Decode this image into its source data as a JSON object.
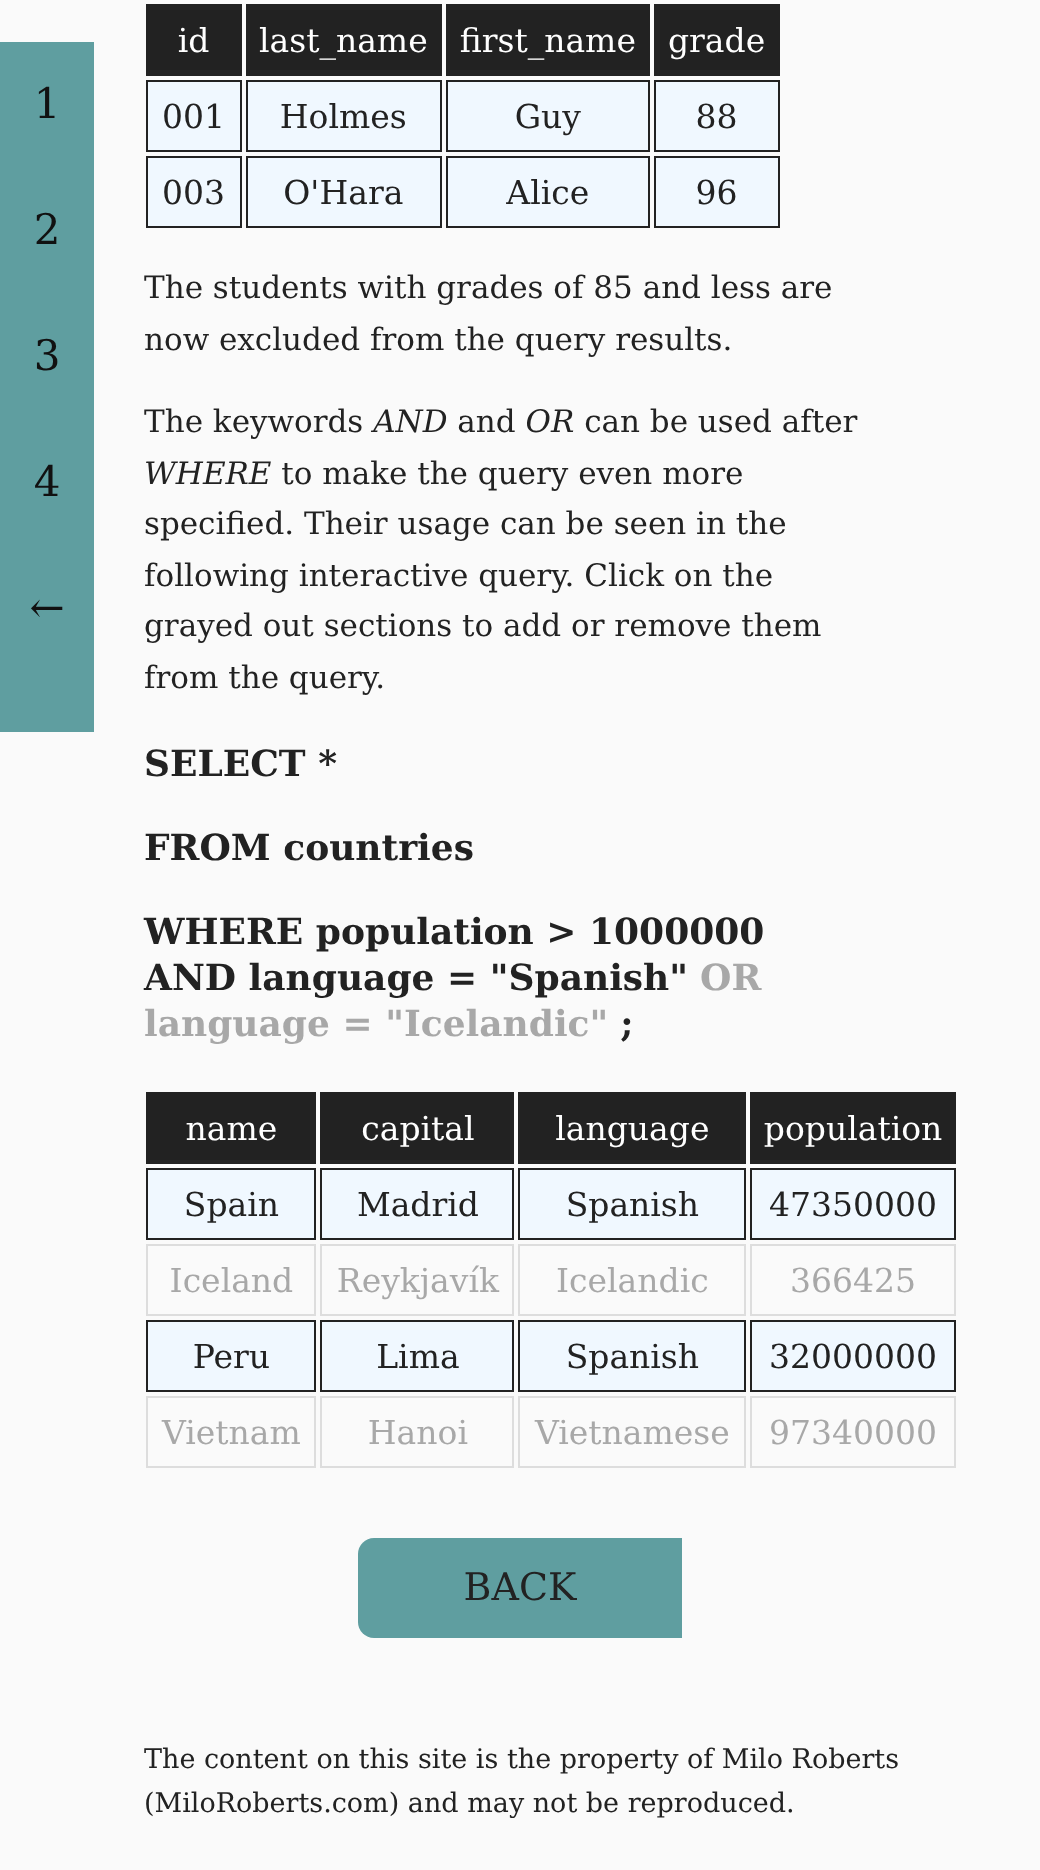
{
  "sidebar": {
    "items": [
      {
        "label": "1"
      },
      {
        "label": "2"
      },
      {
        "label": "3"
      },
      {
        "label": "4"
      },
      {
        "label": "←"
      }
    ]
  },
  "students_table": {
    "columns": [
      "id",
      "last_name",
      "first_name",
      "grade"
    ],
    "rows": [
      {
        "cells": [
          "001",
          "Holmes",
          "Guy",
          "88"
        ]
      },
      {
        "cells": [
          "003",
          "O'Hara",
          "Alice",
          "96"
        ]
      }
    ]
  },
  "paragraphs": [
    "The students with grades of 85 and less are now excluded from the query results.",
    "The keywords *AND* and *OR* can be used after *WHERE* to make the query even more specified. Their usage can be seen in the following interactive query. Click on the grayed out sections to add or remove them from the query."
  ],
  "query": [
    {
      "lines": [
        [
          {
            "text": "SELECT *",
            "included": true
          }
        ]
      ]
    },
    {
      "lines": [
        [
          {
            "text": "FROM countries",
            "included": true
          }
        ]
      ]
    },
    {
      "lines": [
        [
          {
            "text": "WHERE population > 1000000",
            "included": true
          }
        ],
        [
          {
            "text": "AND language = \"Spanish\"",
            "included": true
          },
          {
            "text": "OR",
            "included": false
          }
        ],
        [
          {
            "text": "language = \"Icelandic\"",
            "included": false
          },
          {
            "text": ";",
            "included": true
          }
        ]
      ]
    }
  ],
  "countries_table": {
    "columns": [
      "name",
      "capital",
      "language",
      "population"
    ],
    "rows": [
      {
        "cells": [
          "Spain",
          "Madrid",
          "Spanish",
          "47350000"
        ],
        "included": true
      },
      {
        "cells": [
          "Iceland",
          "Reykjavík",
          "Icelandic",
          "366425"
        ],
        "included": false
      },
      {
        "cells": [
          "Peru",
          "Lima",
          "Spanish",
          "32000000"
        ],
        "included": true
      },
      {
        "cells": [
          "Vietnam",
          "Hanoi",
          "Vietnamese",
          "97340000"
        ],
        "included": false
      }
    ]
  },
  "back_button": {
    "label": "BACK"
  },
  "footer": "The content on this site is the property of Milo Roberts (MiloRoberts.com) and may not be reproduced."
}
